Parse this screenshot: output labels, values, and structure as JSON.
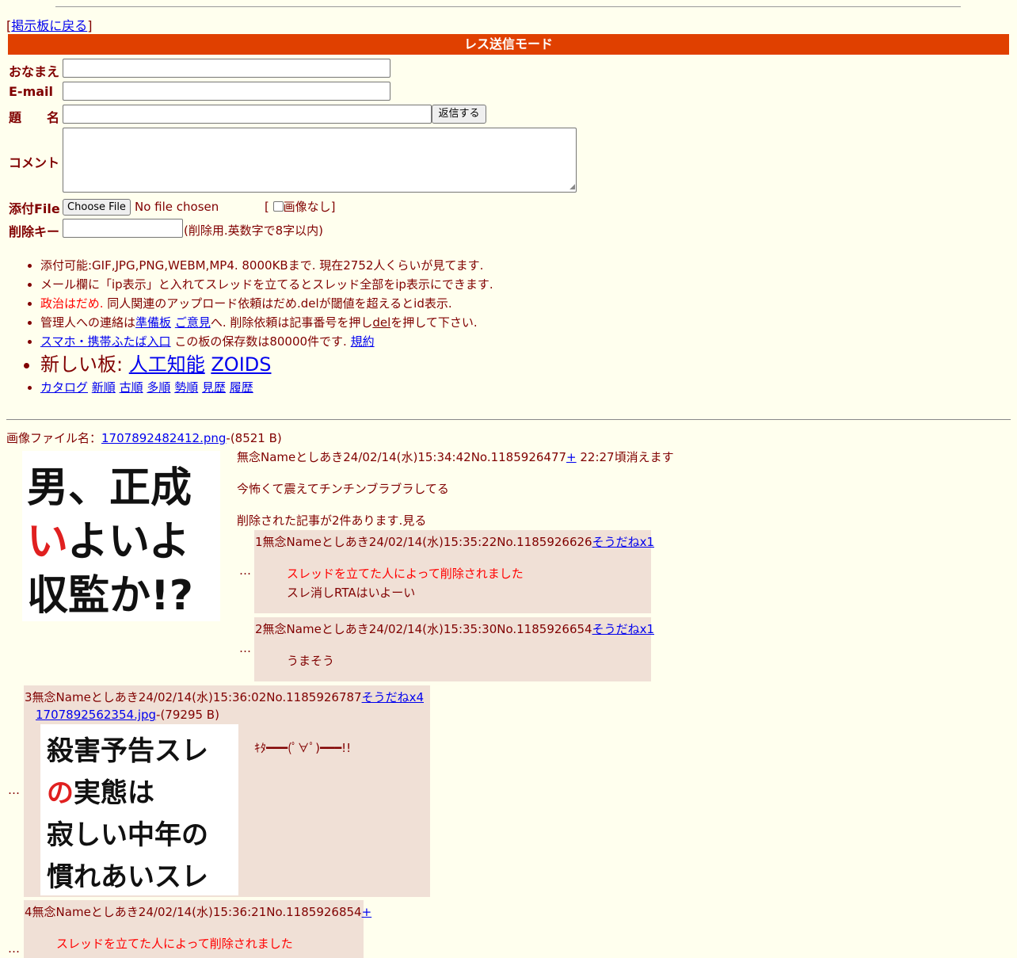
{
  "nav": {
    "back_open": "[",
    "back_label": "掲示板に戻る",
    "back_close": "]"
  },
  "form": {
    "mode_title": "レス送信モード",
    "name_label": "おなまえ",
    "email_label": "E-mail",
    "subject_label": "題　　名",
    "submit_label": "返信する",
    "comment_label": "コメント",
    "file_label": "添付File",
    "choose_file_label": "Choose File",
    "no_file_text": "No file chosen",
    "no_image_open": "[",
    "no_image_label": "画像なし",
    "no_image_close": "]",
    "delkey_label": "削除キー",
    "delkey_hint": "(削除用.英数字で8字以内)"
  },
  "rules": {
    "line1": "添付可能:GIF,JPG,PNG,WEBM,MP4. 8000KBまで. 現在2752人くらいが見てます.",
    "line2": "メール欄に「ip表示」と入れてスレッドを立てるとスレッド全部をip表示にできます.",
    "line3_red": "政治はだめ.",
    "line3_rest": " 同人関連のアップロード依頼はだめ.delが閾値を超えるとid表示.",
    "line4_a": "管理人への連絡は",
    "line4_link1": "準備板",
    "line4_link2": "ご意見",
    "line4_b": "へ. 削除依頼は記事番号を押し",
    "line4_del": "del",
    "line4_c": "を押して下さい.",
    "line5_link": "スマホ・携帯ふたば入口",
    "line5_text": " この板の保存数は80000件です. ",
    "line5_rules": "規約",
    "line6_label": "新しい板: ",
    "line6_link1": "人工知能",
    "line6_link2": "ZOIDS",
    "links": [
      "カタログ",
      "新順",
      "古順",
      "多順",
      "勢順",
      "見歴",
      "履歴"
    ]
  },
  "thread": {
    "file_prefix": "画像ファイル名：",
    "file_name": "1707892482412.png",
    "file_size": "-(8521 B)",
    "op_header": "無念Nameとしあき24/02/14(水)15:34:42No.1185926477",
    "op_plus": "+",
    "op_expire": " 22:27頃消えます",
    "op_body": "今怖くて震えてチンチンブラブラしてる",
    "op_thumb_lines": [
      "男、正成",
      "いよいよ",
      "収監か!?"
    ],
    "op_thumb_red": "い",
    "deleted_notice": "削除された記事が2件あります.見る",
    "dots": "…"
  },
  "replies": [
    {
      "header": "1無念Nameとしあき24/02/14(水)15:35:22No.1185926626",
      "sodane": "そうだねx1",
      "lines": [
        "スレッドを立てた人によって削除されました",
        "スレ消しRTAはいよーい"
      ]
    },
    {
      "header": "2無念Nameとしあき24/02/14(水)15:35:30No.1185926654",
      "sodane": "そうだねx1",
      "lines": [
        "うまそう"
      ]
    },
    {
      "header": "3無念Nameとしあき24/02/14(水)15:36:02No.1185926787",
      "sodane": "そうだねx4",
      "file_name": "1707892562354.jpg",
      "file_size": "-(79295 B)",
      "body": "ｷﾀ━━━(ﾟ∀ﾟ)━━━!!",
      "thumb_lines": [
        "殺害予告スレ",
        "の実態は",
        "寂しい中年の",
        "慣れあいスレ"
      ],
      "thumb_red": "の"
    },
    {
      "header": "4無念Nameとしあき24/02/14(水)15:36:21No.1185926854",
      "sodane": "+",
      "lines": [
        "スレッドを立てた人によって削除されました"
      ]
    }
  ]
}
